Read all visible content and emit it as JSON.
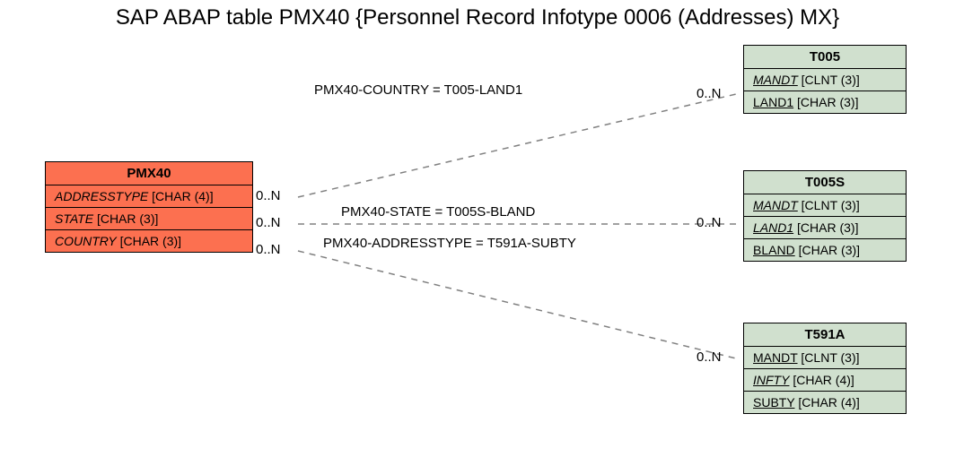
{
  "title": "SAP ABAP table PMX40 {Personnel Record Infotype 0006 (Addresses)  MX}",
  "entities": {
    "pmx40": {
      "name": "PMX40",
      "fields": [
        {
          "name": "ADDRESSTYPE",
          "type": "[CHAR (4)]",
          "italic": true,
          "underline": false
        },
        {
          "name": "STATE",
          "type": "[CHAR (3)]",
          "italic": true,
          "underline": false
        },
        {
          "name": "COUNTRY",
          "type": "[CHAR (3)]",
          "italic": true,
          "underline": false
        }
      ]
    },
    "t005": {
      "name": "T005",
      "fields": [
        {
          "name": "MANDT",
          "type": "[CLNT (3)]",
          "italic": true,
          "underline": true
        },
        {
          "name": "LAND1",
          "type": "[CHAR (3)]",
          "italic": false,
          "underline": true
        }
      ]
    },
    "t005s": {
      "name": "T005S",
      "fields": [
        {
          "name": "MANDT",
          "type": "[CLNT (3)]",
          "italic": true,
          "underline": true
        },
        {
          "name": "LAND1",
          "type": "[CHAR (3)]",
          "italic": true,
          "underline": true
        },
        {
          "name": "BLAND",
          "type": "[CHAR (3)]",
          "italic": false,
          "underline": true
        }
      ]
    },
    "t591a": {
      "name": "T591A",
      "fields": [
        {
          "name": "MANDT",
          "type": "[CLNT (3)]",
          "italic": false,
          "underline": true
        },
        {
          "name": "INFTY",
          "type": "[CHAR (4)]",
          "italic": true,
          "underline": true
        },
        {
          "name": "SUBTY",
          "type": "[CHAR (4)]",
          "italic": false,
          "underline": true
        }
      ]
    }
  },
  "relations": {
    "r1": {
      "text": "PMX40-COUNTRY = T005-LAND1",
      "left_card": "0..N",
      "right_card": "0..N"
    },
    "r2": {
      "text": "PMX40-STATE = T005S-BLAND",
      "left_card": "0..N",
      "right_card": "0..N"
    },
    "r3": {
      "text": "PMX40-ADDRESSTYPE = T591A-SUBTY",
      "left_card": "0..N",
      "right_card": "0..N"
    }
  }
}
